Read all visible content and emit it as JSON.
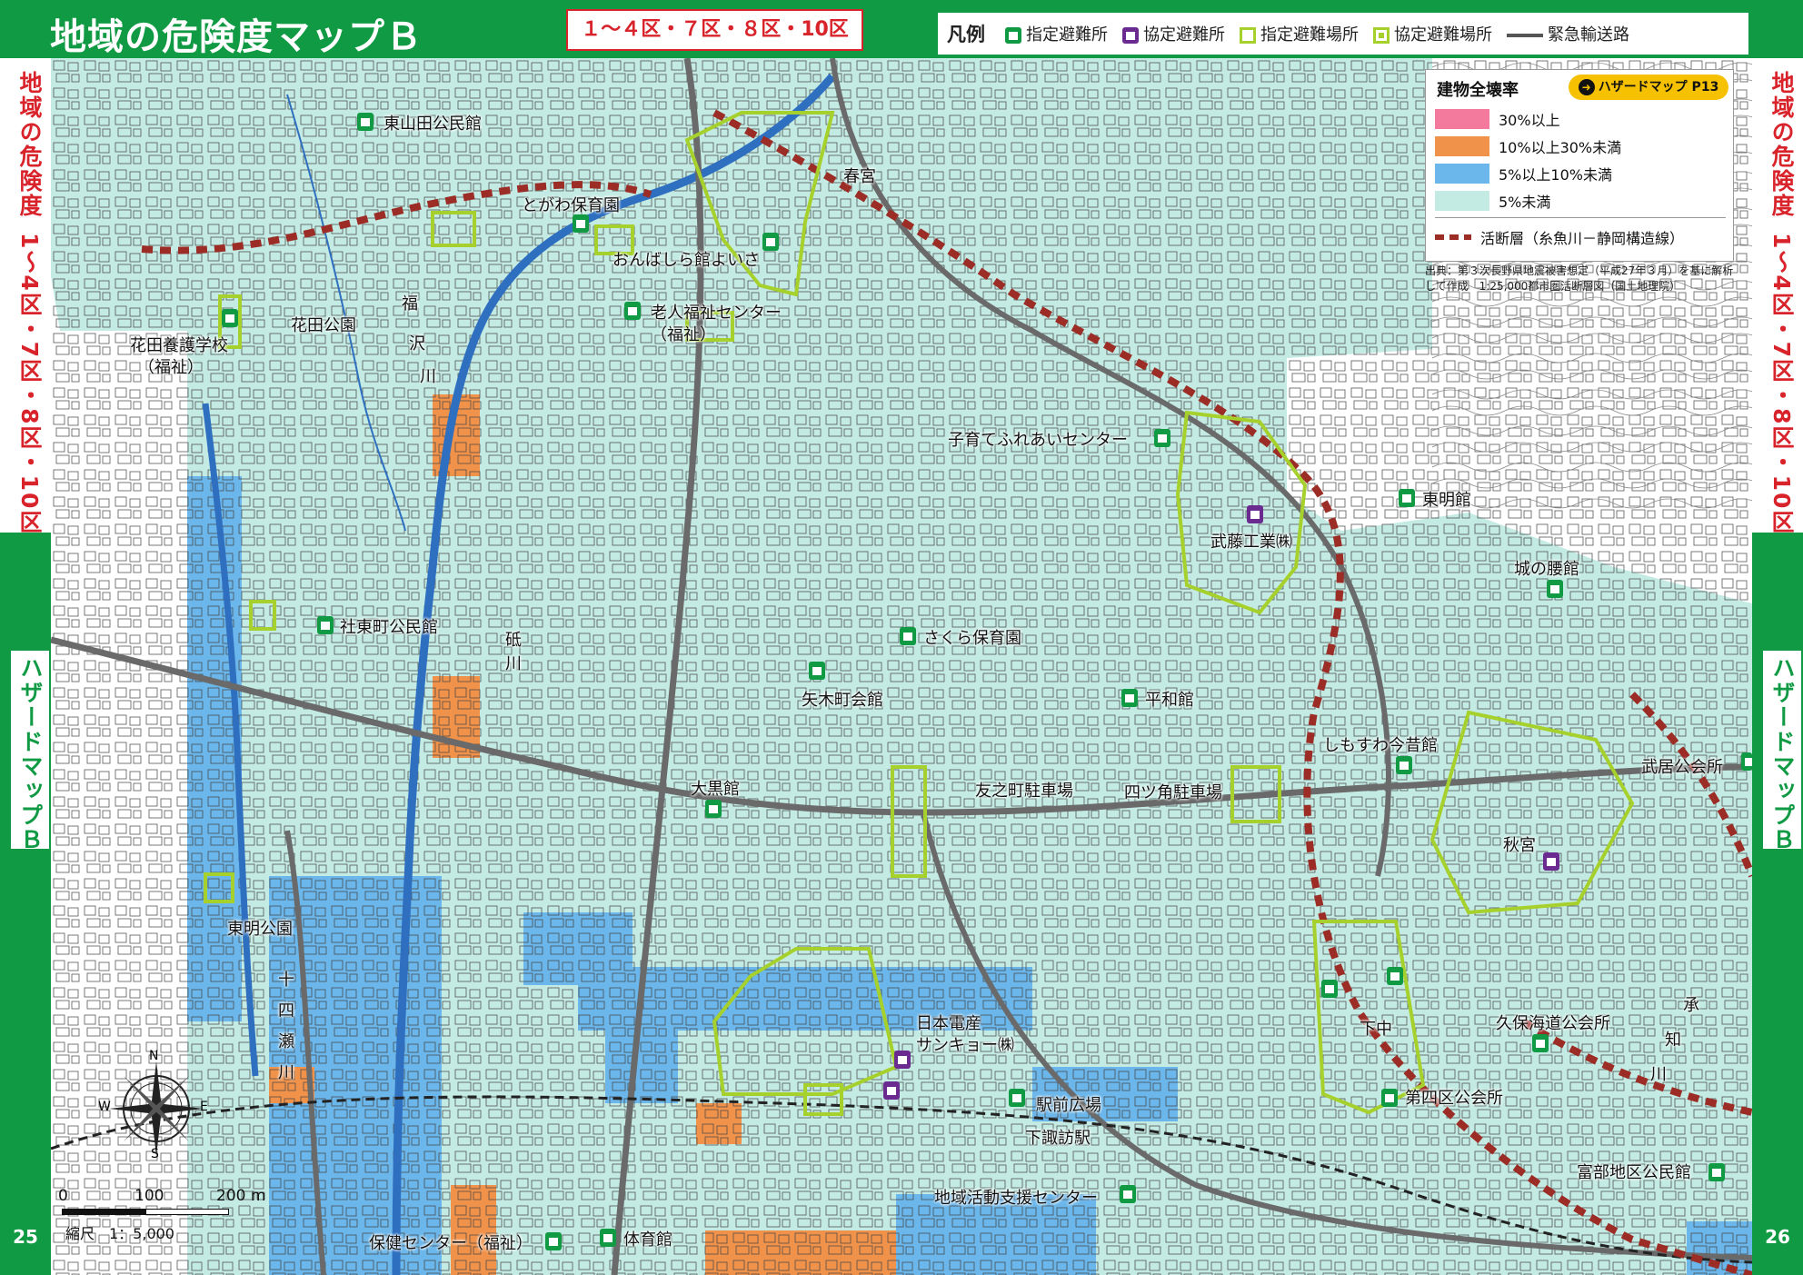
{
  "header": {
    "title": "地域の危険度マップＢ",
    "areas": "１～４区・７区・８区・10区"
  },
  "legend": {
    "label": "凡例",
    "items": [
      {
        "icon": "designated-shelter-icon",
        "text": "指定避難所"
      },
      {
        "icon": "agreement-shelter-icon",
        "text": "協定避難所"
      },
      {
        "icon": "designated-evacuation-site-icon",
        "text": "指定避難場所"
      },
      {
        "icon": "agreement-evacuation-site-icon",
        "text": "協定避難場所"
      },
      {
        "icon": "emergency-road-icon",
        "text": "緊急輸送路"
      }
    ]
  },
  "left_tab": {
    "heading": "地域の危険度",
    "areas": "1～4区・7区・8区・10区",
    "hazard": "ハザードマップＢ",
    "page": "25"
  },
  "right_tab": {
    "heading": "地域の危険度",
    "areas": "1～4区・7区・8区・10区",
    "hazard": "ハザードマップＢ",
    "page": "26"
  },
  "risk_legend": {
    "title": "建物全壊率",
    "link": "ハザードマップ P13",
    "rows": [
      {
        "color": "#f47a9d",
        "label": "30%以上"
      },
      {
        "color": "#f0924a",
        "label": "10%以上30%未満"
      },
      {
        "color": "#6bb6ea",
        "label": "5%以上10%未満"
      },
      {
        "color": "#c4ebe3",
        "label": "5%未満"
      }
    ],
    "fault": "活断層（糸魚川－静岡構造線）",
    "source": "出典：第３次長野県地震被害想定（平成27年３月）を基に解析して作成　1:25,000都市圏活断層図（国土地理院）"
  },
  "colors": {
    "brand_green": "#0f9a43",
    "accent_red": "#d9232b",
    "site_outline": "#a6d12d",
    "fault_line": "#9b2d26",
    "river": "#2f6fc0",
    "road": "#6a6a6a",
    "low_risk": "#c4ebe3"
  },
  "places": [
    {
      "name": "東山田公民館",
      "type": "designated-shelter"
    },
    {
      "name": "とがわ保育園",
      "type": "designated-shelter"
    },
    {
      "name": "おんばしら館よいさ",
      "type": "designated-shelter"
    },
    {
      "name": "春宮",
      "type": "designated-evacuation-site"
    },
    {
      "name": "老人福祉センター",
      "type": "designated-shelter"
    },
    {
      "name": "（福祉）",
      "type": "note"
    },
    {
      "name": "花田公園",
      "type": "designated-evacuation-site"
    },
    {
      "name": "花田養護学校",
      "type": "designated-shelter"
    },
    {
      "name": "（福祉）",
      "type": "note"
    },
    {
      "name": "子育てふれあいセンター",
      "type": "designated-shelter"
    },
    {
      "name": "東明館",
      "type": "designated-shelter"
    },
    {
      "name": "武藤工業㈱",
      "type": "agreement-shelter"
    },
    {
      "name": "城の腰館",
      "type": "designated-shelter"
    },
    {
      "name": "社東町公民館",
      "type": "designated-shelter"
    },
    {
      "name": "さくら保育園",
      "type": "designated-shelter"
    },
    {
      "name": "矢木町会館",
      "type": "designated-shelter"
    },
    {
      "name": "平和館",
      "type": "designated-shelter"
    },
    {
      "name": "しもすわ今昔館",
      "type": "designated-shelter"
    },
    {
      "name": "武居公会所",
      "type": "designated-shelter"
    },
    {
      "name": "大黒館",
      "type": "designated-shelter"
    },
    {
      "name": "友之町駐車場",
      "type": "designated-evacuation-site"
    },
    {
      "name": "四ツ角駐車場",
      "type": "designated-evacuation-site"
    },
    {
      "name": "秋宮",
      "type": "agreement-shelter"
    },
    {
      "name": "東明公園",
      "type": "designated-evacuation-site"
    },
    {
      "name": "日本電産",
      "type": "agreement-shelter"
    },
    {
      "name": "サンキョー㈱",
      "type": "agreement-shelter"
    },
    {
      "name": "駅前広場",
      "type": "designated-evacuation-site"
    },
    {
      "name": "下諏訪駅",
      "type": "station"
    },
    {
      "name": "下中",
      "type": "designated-shelter"
    },
    {
      "name": "久保海道公会所",
      "type": "designated-shelter"
    },
    {
      "name": "第四区公会所",
      "type": "designated-shelter"
    },
    {
      "name": "富部地区公民館",
      "type": "designated-shelter"
    },
    {
      "name": "地域活動支援センター",
      "type": "designated-shelter"
    },
    {
      "name": "保健センター（福祉）",
      "type": "designated-shelter"
    },
    {
      "name": "体育館",
      "type": "designated-shelter"
    }
  ],
  "rivers": [
    "福",
    "沢",
    "川",
    "砥",
    "川",
    "十",
    "四",
    "瀬",
    "川",
    "承",
    "知",
    "川"
  ],
  "scale": {
    "ticks": [
      "0",
      "100",
      "200 m"
    ],
    "ratio": "縮尺　1：5,000"
  },
  "compass": {
    "n": "N",
    "s": "S",
    "e": "E",
    "w": "W"
  }
}
